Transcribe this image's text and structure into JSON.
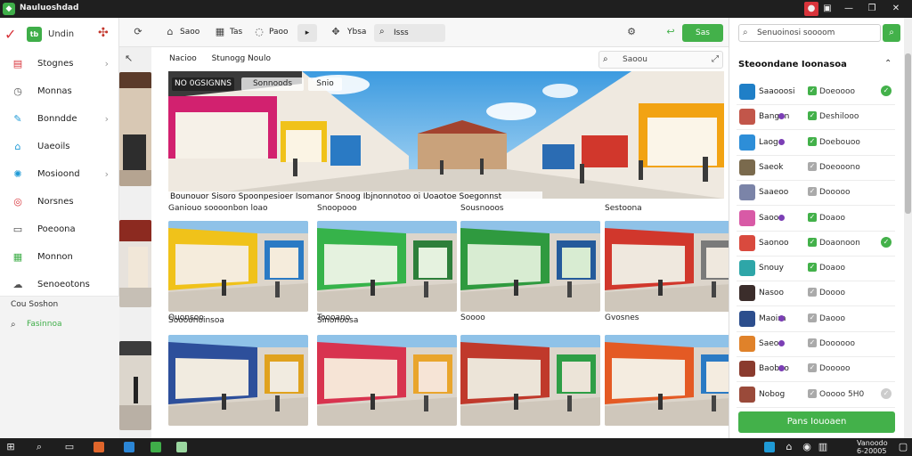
{
  "window": {
    "title": "Nauluoshdad",
    "controls": [
      "minimize",
      "restore",
      "close"
    ]
  },
  "nav": {
    "brand": "Undin",
    "items": [
      {
        "label": "Stognes",
        "icon": "store-icon",
        "chevron": true,
        "color": "#d8343b"
      },
      {
        "label": "Monnas",
        "icon": "clock-icon",
        "chevron": false,
        "color": "#555555"
      },
      {
        "label": "Bonndde",
        "icon": "pencil-icon",
        "chevron": true,
        "color": "#1f9ad6"
      },
      {
        "label": "Uaeoils",
        "icon": "home-icon",
        "chevron": false,
        "color": "#1f9ad6"
      },
      {
        "label": "Mosioond",
        "icon": "gear-icon",
        "chevron": true,
        "color": "#1f9ad6"
      },
      {
        "label": "Norsnes",
        "icon": "target-icon",
        "chevron": false,
        "color": "#d8343b"
      },
      {
        "label": "Poeoona",
        "icon": "document-icon",
        "chevron": false,
        "color": "#444444"
      },
      {
        "label": "Monnon",
        "icon": "grid-icon",
        "chevron": false,
        "color": "#3fae49"
      },
      {
        "label": "Senoeotons",
        "icon": "cloud-icon",
        "chevron": false,
        "color": "#555555"
      }
    ],
    "footer": [
      "Cou Soshon",
      "Fasinnoa"
    ]
  },
  "toolbar": {
    "items": [
      {
        "icon": "home-icon",
        "label": "Saoo"
      },
      {
        "icon": "table-icon",
        "label": "Tas"
      },
      {
        "icon": "comment-icon",
        "label": "Paoo"
      },
      {
        "icon": "move-icon",
        "label": "Ybsa"
      },
      {
        "icon": "search-icon",
        "label": "Isss"
      }
    ],
    "action_label": "Sas"
  },
  "main": {
    "breadcrumb": [
      "Nacioo",
      "Stunogg Noulo"
    ],
    "search_placeholder": "Saoou",
    "hero": {
      "tags": [
        "NO 0GSIGNNS",
        "Sonnoods",
        "Snio"
      ],
      "caption": "Bounouor Sisoro Spoonpesioer Isomanor Snoog Ibjnonnotoo oi Uoaotoe Soegonnst"
    },
    "cards": [
      {
        "title": "Ganiouo soooonbon loao"
      },
      {
        "title": "Snoopooo"
      },
      {
        "title": "Sousnooos"
      },
      {
        "title": "Sestoona"
      },
      {
        "title": "Soooonoinsoa"
      },
      {
        "title": "Sinonoosa"
      },
      {
        "title": ""
      },
      {
        "title": ""
      },
      {
        "title": "Ouonsoo"
      },
      {
        "title": "Toooano"
      },
      {
        "title": "Soooo"
      },
      {
        "title": "Gvosnes"
      }
    ]
  },
  "right": {
    "search_placeholder": "Senuoinosi soooom",
    "heading": "Steoondane Ioonasoa",
    "items": [
      {
        "name": "Saaooosi",
        "dot": false,
        "status": "Doeoooo",
        "check": "#43b14a",
        "tail": "#43b14a",
        "thumb": "#1f7fc7"
      },
      {
        "name": "Bangan",
        "dot": true,
        "status": "Deshilooo",
        "check": "#43b14a",
        "tail": "",
        "thumb": "#c2564a"
      },
      {
        "name": "Laoge",
        "dot": true,
        "status": "Doebouoo",
        "check": "#43b14a",
        "tail": "",
        "thumb": "#2d8ed8"
      },
      {
        "name": "Saeok",
        "dot": false,
        "status": "Doeooono",
        "check": "#aaaaaa",
        "tail": "",
        "thumb": "#7a6a4d"
      },
      {
        "name": "Saaeoo",
        "dot": false,
        "status": "Dooooo",
        "check": "#aaaaaa",
        "tail": "",
        "thumb": "#7b84a8"
      },
      {
        "name": "Saoo",
        "dot": true,
        "status": "Doaoo",
        "check": "#43b14a",
        "tail": "",
        "thumb": "#d85aa6"
      },
      {
        "name": "Saonoo",
        "dot": false,
        "status": "Doaonoon",
        "check": "#43b14a",
        "tail": "#43b14a",
        "thumb": "#d94a3e"
      },
      {
        "name": "Snouy",
        "dot": false,
        "status": "Doaoo",
        "check": "#43b14a",
        "tail": "",
        "thumb": "#2ea6a8"
      },
      {
        "name": "Nasoo",
        "dot": false,
        "status": "Doooo",
        "check": "#aaaaaa",
        "tail": "",
        "thumb": "#3b2d2b"
      },
      {
        "name": "Maoira",
        "dot": true,
        "status": "Daooo",
        "check": "#aaaaaa",
        "tail": "",
        "thumb": "#2c4e8d"
      },
      {
        "name": "Saeoo",
        "dot": true,
        "status": "Doooooo",
        "check": "#aaaaaa",
        "tail": "",
        "thumb": "#e0822a"
      },
      {
        "name": "Baoboo",
        "dot": true,
        "status": "Dooooo",
        "check": "#aaaaaa",
        "tail": "",
        "thumb": "#8a3b2e"
      },
      {
        "name": "Nobog",
        "dot": false,
        "status": "Ooooo 5H0",
        "check": "#aaaaaa",
        "tail": "#cccccc",
        "thumb": "#9a4a3a"
      }
    ],
    "button_label": "Pans Iouoaen"
  },
  "taskbar": {
    "tray": [
      "Vanoodo",
      "6-20005"
    ]
  },
  "colors": {
    "accent": "#43b14a",
    "brand_red": "#d8343b"
  }
}
